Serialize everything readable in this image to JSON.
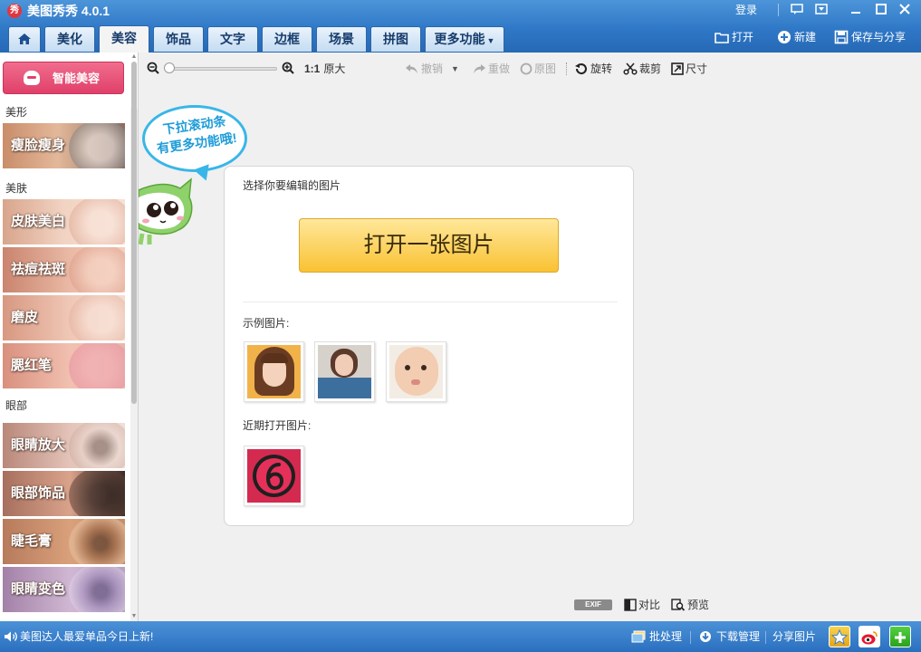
{
  "app": {
    "title": "美图秀秀 4.0.1",
    "logo_text": "秀",
    "login": "登录"
  },
  "window_controls": [
    {
      "name": "feedback-icon",
      "glyph": "▭"
    },
    {
      "name": "menu-icon",
      "glyph": "▣"
    },
    {
      "name": "minimize-icon",
      "glyph": "—"
    },
    {
      "name": "maximize-icon",
      "glyph": "☐"
    },
    {
      "name": "close-icon",
      "glyph": "✕"
    }
  ],
  "tabs": [
    {
      "label": "美化"
    },
    {
      "label": "美容",
      "active": true
    },
    {
      "label": "饰品"
    },
    {
      "label": "文字"
    },
    {
      "label": "边框"
    },
    {
      "label": "场景"
    },
    {
      "label": "拼图"
    },
    {
      "label": "更多功能"
    }
  ],
  "top_actions": {
    "open": "打开",
    "new": "新建",
    "save_share": "保存与分享"
  },
  "sidebar": {
    "smart_beauty": "智能美容",
    "sections": {
      "shape": "美形",
      "skin": "美肤",
      "eyes": "眼部"
    },
    "tools": [
      {
        "label": "瘦脸瘦身"
      },
      {
        "label": "皮肤美白"
      },
      {
        "label": "祛痘祛斑"
      },
      {
        "label": "磨皮"
      },
      {
        "label": "腮红笔"
      },
      {
        "label": "眼睛放大"
      },
      {
        "label": "眼部饰品"
      },
      {
        "label": "睫毛膏"
      },
      {
        "label": "眼睛变色"
      }
    ]
  },
  "toolbar": {
    "zoom_ratio": "1:1",
    "original_size": "原大",
    "undo": "撤销",
    "redo": "重做",
    "original": "原图",
    "rotate": "旋转",
    "crop": "裁剪",
    "size": "尺寸",
    "zoom_level": 0
  },
  "mascot": {
    "bubble_line1": "下拉滚动条",
    "bubble_line2": "有更多功能哦!"
  },
  "card": {
    "title": "选择你要编辑的图片",
    "open_button": "打开一张图片",
    "examples_label": "示例图片:",
    "recent_label": "近期打开图片:"
  },
  "bottom_tools": {
    "exif": "EXIF",
    "compare": "对比",
    "preview": "预览"
  },
  "statusbar": {
    "news": "美图达人最爱单品今日上新!",
    "batch": "批处理",
    "download": "下载管理",
    "share": "分享图片"
  },
  "colors": {
    "title_bar": "#2f78c7",
    "smart_button": "#e0406a",
    "open_button": "#f9c233",
    "bubble": "#39b6e8"
  }
}
